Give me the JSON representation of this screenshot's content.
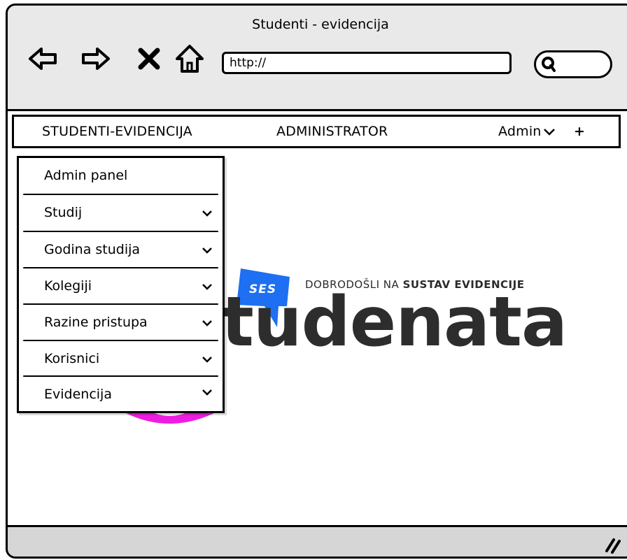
{
  "window": {
    "title": "Studenti - evidencija"
  },
  "browser": {
    "url": {
      "value": "http://"
    },
    "search": {
      "placeholder": ""
    }
  },
  "menubar": {
    "brand": "STUDENTI-EVIDENCIJA",
    "admin_section": "ADMINISTRATOR",
    "user_menu": "Admin",
    "plus": "+"
  },
  "dropdown": {
    "items": [
      {
        "label": "Admin panel",
        "has_chevron": false
      },
      {
        "label": "Studij",
        "has_chevron": true
      },
      {
        "label": "Godina studija",
        "has_chevron": true
      },
      {
        "label": "Kolegiji",
        "has_chevron": true
      },
      {
        "label": "Razine pristupa",
        "has_chevron": true
      },
      {
        "label": "Korisnici",
        "has_chevron": true
      },
      {
        "label": "Evidencija",
        "has_chevron": true
      }
    ]
  },
  "logo": {
    "badge": "SES",
    "tagline_light": "DOBRODOŠLI NA ",
    "tagline_bold": "SUSTAV EVIDENCIJE",
    "wordmark": "tudenata",
    "badge_color": "#1e6ff1",
    "accent_color": "#ee1ee0"
  }
}
